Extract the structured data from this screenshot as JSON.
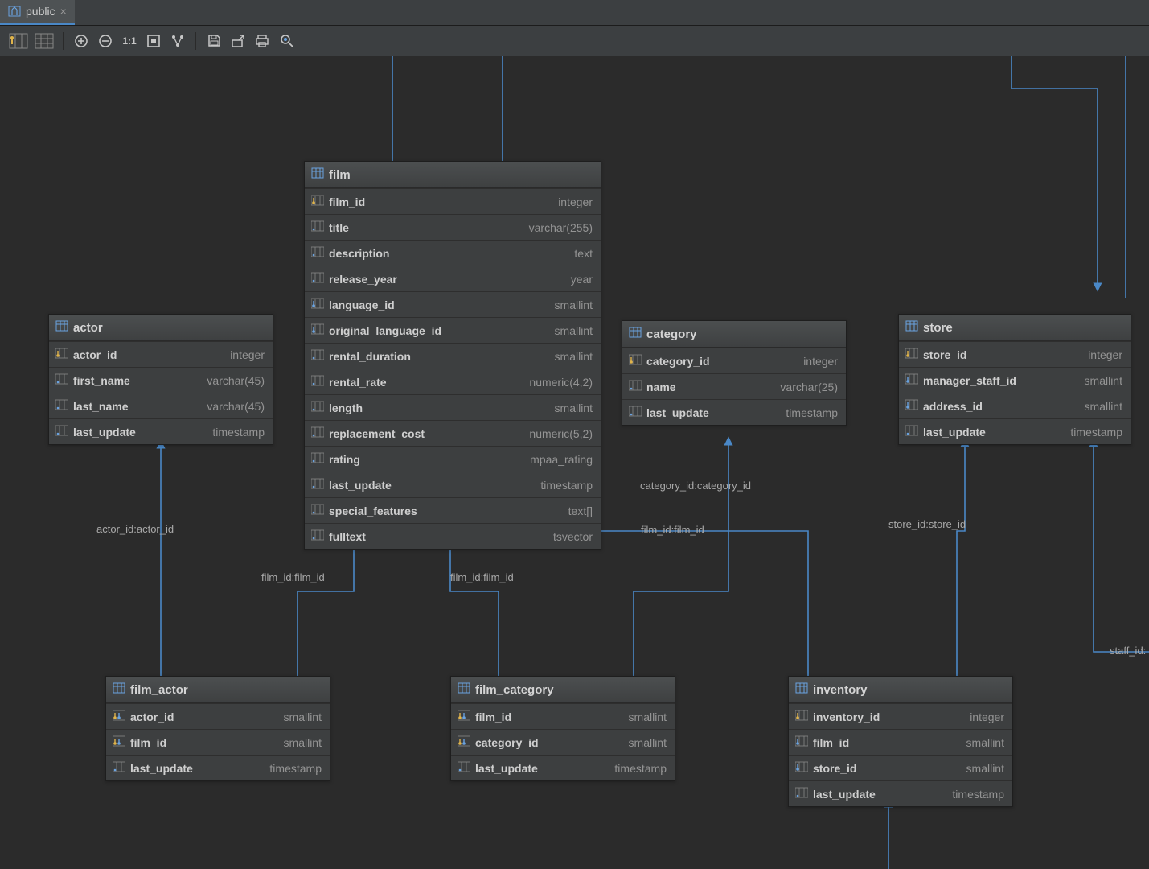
{
  "tab": {
    "label": "public"
  },
  "entities": {
    "actor": {
      "name": "actor",
      "columns": [
        {
          "name": "actor_id",
          "type": "integer",
          "ico": "pk"
        },
        {
          "name": "first_name",
          "type": "varchar(45)",
          "ico": "col"
        },
        {
          "name": "last_name",
          "type": "varchar(45)",
          "ico": "col"
        },
        {
          "name": "last_update",
          "type": "timestamp",
          "ico": "col"
        }
      ]
    },
    "film": {
      "name": "film",
      "columns": [
        {
          "name": "film_id",
          "type": "integer",
          "ico": "pk"
        },
        {
          "name": "title",
          "type": "varchar(255)",
          "ico": "col"
        },
        {
          "name": "description",
          "type": "text",
          "ico": "col"
        },
        {
          "name": "release_year",
          "type": "year",
          "ico": "col"
        },
        {
          "name": "language_id",
          "type": "smallint",
          "ico": "fk"
        },
        {
          "name": "original_language_id",
          "type": "smallint",
          "ico": "fk"
        },
        {
          "name": "rental_duration",
          "type": "smallint",
          "ico": "col"
        },
        {
          "name": "rental_rate",
          "type": "numeric(4,2)",
          "ico": "col"
        },
        {
          "name": "length",
          "type": "smallint",
          "ico": "col"
        },
        {
          "name": "replacement_cost",
          "type": "numeric(5,2)",
          "ico": "col"
        },
        {
          "name": "rating",
          "type": "mpaa_rating",
          "ico": "col"
        },
        {
          "name": "last_update",
          "type": "timestamp",
          "ico": "col"
        },
        {
          "name": "special_features",
          "type": "text[]",
          "ico": "col"
        },
        {
          "name": "fulltext",
          "type": "tsvector",
          "ico": "col"
        }
      ]
    },
    "category": {
      "name": "category",
      "columns": [
        {
          "name": "category_id",
          "type": "integer",
          "ico": "pk"
        },
        {
          "name": "name",
          "type": "varchar(25)",
          "ico": "col"
        },
        {
          "name": "last_update",
          "type": "timestamp",
          "ico": "col"
        }
      ]
    },
    "store": {
      "name": "store",
      "columns": [
        {
          "name": "store_id",
          "type": "integer",
          "ico": "pk"
        },
        {
          "name": "manager_staff_id",
          "type": "smallint",
          "ico": "fk"
        },
        {
          "name": "address_id",
          "type": "smallint",
          "ico": "fk"
        },
        {
          "name": "last_update",
          "type": "timestamp",
          "ico": "col"
        }
      ]
    },
    "film_actor": {
      "name": "film_actor",
      "columns": [
        {
          "name": "actor_id",
          "type": "smallint",
          "ico": "pkfk"
        },
        {
          "name": "film_id",
          "type": "smallint",
          "ico": "pkfk"
        },
        {
          "name": "last_update",
          "type": "timestamp",
          "ico": "col"
        }
      ]
    },
    "film_category": {
      "name": "film_category",
      "columns": [
        {
          "name": "film_id",
          "type": "smallint",
          "ico": "pkfk"
        },
        {
          "name": "category_id",
          "type": "smallint",
          "ico": "pkfk"
        },
        {
          "name": "last_update",
          "type": "timestamp",
          "ico": "col"
        }
      ]
    },
    "inventory": {
      "name": "inventory",
      "columns": [
        {
          "name": "inventory_id",
          "type": "integer",
          "ico": "pk"
        },
        {
          "name": "film_id",
          "type": "smallint",
          "ico": "fk"
        },
        {
          "name": "store_id",
          "type": "smallint",
          "ico": "fk"
        },
        {
          "name": "last_update",
          "type": "timestamp",
          "ico": "col"
        }
      ]
    }
  },
  "link_labels": {
    "actor_fa": "actor_id:actor_id",
    "film_fa": "film_id:film_id",
    "film_fc": "film_id:film_id",
    "film_inv": "film_id:film_id",
    "cat_fc": "category_id:category_id",
    "store_inv": "store_id:store_id",
    "staff_store": "staff_id:"
  }
}
